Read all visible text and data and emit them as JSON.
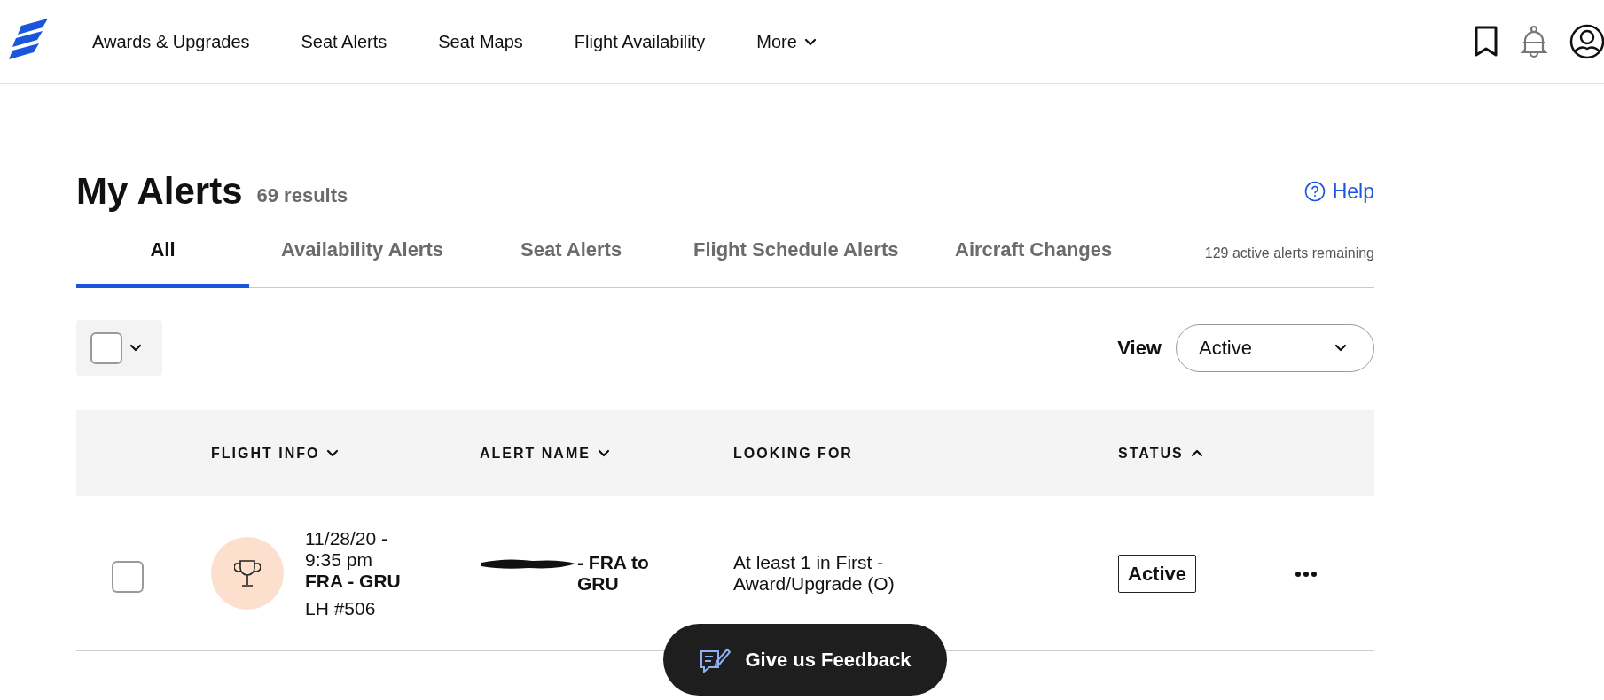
{
  "nav": {
    "items": [
      {
        "label": "Awards & Upgrades",
        "kind": "link"
      },
      {
        "label": "Seat Alerts",
        "kind": "link"
      },
      {
        "label": "Seat Maps",
        "kind": "link"
      },
      {
        "label": "Flight Availability",
        "kind": "link"
      },
      {
        "label": "More",
        "kind": "menu"
      }
    ]
  },
  "page": {
    "title": "My Alerts",
    "result_count": "69 results",
    "help_link": "Help"
  },
  "tabs": [
    {
      "label": "All",
      "selected": true
    },
    {
      "label": "Availability Alerts",
      "selected": false
    },
    {
      "label": "Seat Alerts",
      "selected": false
    },
    {
      "label": "Flight Schedule Alerts",
      "selected": false
    },
    {
      "label": "Aircraft Changes",
      "selected": false
    }
  ],
  "remaining": "129 active alerts remaining",
  "select_all": {
    "checked": false
  },
  "view": {
    "label": "View",
    "value": "Active"
  },
  "table": {
    "columns": [
      {
        "label": "FLIGHT INFO",
        "sort_ascending": false
      },
      {
        "label": "ALERT NAME",
        "sort_ascending": false
      },
      {
        "label": "LOOKING FOR"
      },
      {
        "label": "STATUS",
        "sort_ascending": true
      }
    ],
    "rows": [
      {
        "checked": false,
        "date_time": "11/28/20 - 9:35 pm",
        "route": "FRA - GRU",
        "flight_number": "LH #506",
        "name_redacted": true,
        "alert_name": "- FRA to GRU",
        "looking_for": "At least 1 in First - Award/Upgrade (O)",
        "status": "Active"
      }
    ]
  },
  "feedback_button": "Give us Feedback"
}
